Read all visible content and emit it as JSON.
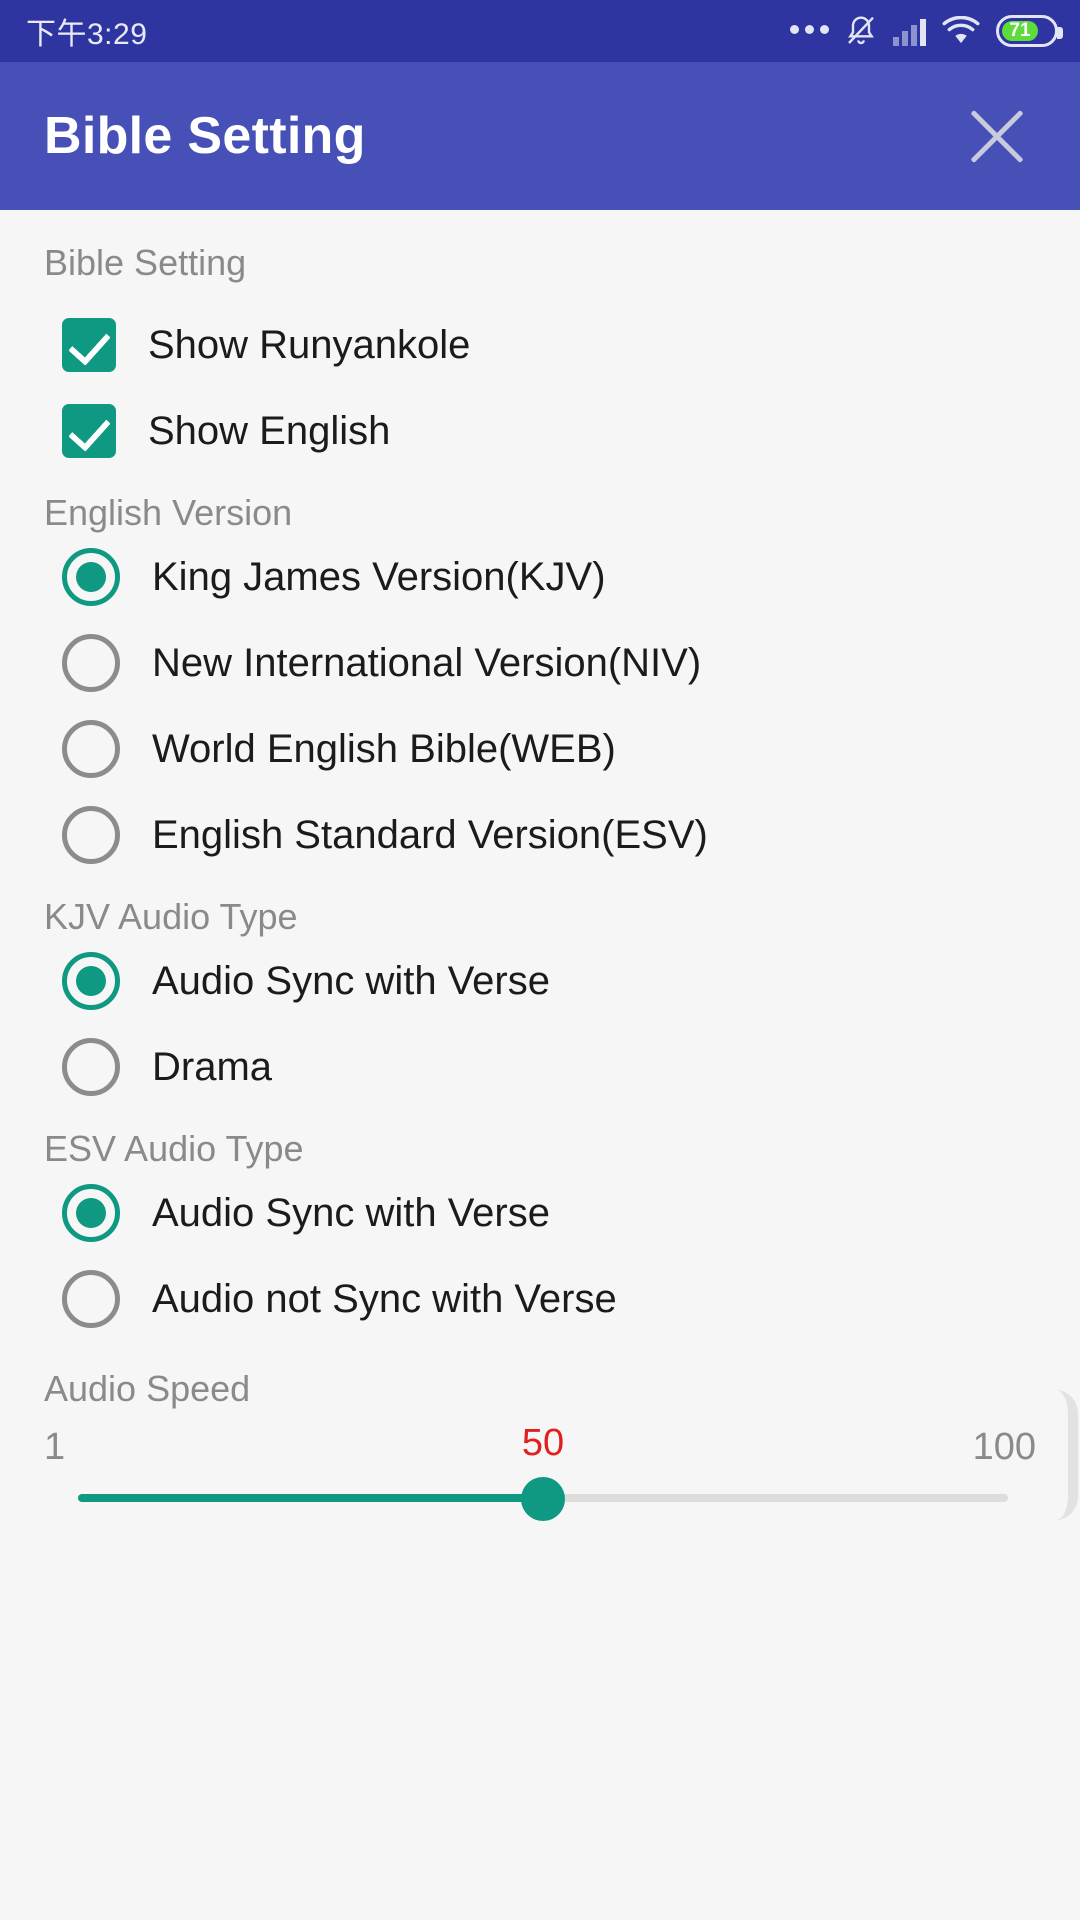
{
  "statusbar": {
    "time": "下午3:29",
    "icons": [
      "more-dots-icon",
      "notifications-off-icon",
      "signal-no-service-icon",
      "wifi-icon",
      "battery-icon"
    ],
    "battery_percent": "71"
  },
  "appbar": {
    "title": "Bible Setting",
    "close_label": "close-icon",
    "background": "#4650b7"
  },
  "theme": {
    "accent": "#0f9882",
    "status_bar_bg": "#2f35a0",
    "page_bg": "#f6f6f6",
    "label_color": "#8a8a8a",
    "value_highlight": "#e02020"
  },
  "sections": {
    "bible_setting": {
      "label": "Bible Setting",
      "checkboxes": [
        {
          "label": "Show Runyankole",
          "checked": true
        },
        {
          "label": "Show English",
          "checked": true
        }
      ]
    },
    "english_version": {
      "label": "English Version",
      "options": [
        {
          "label": "King James Version(KJV)",
          "selected": true
        },
        {
          "label": "New International Version(NIV)",
          "selected": false
        },
        {
          "label": "World English Bible(WEB)",
          "selected": false
        },
        {
          "label": "English Standard Version(ESV)",
          "selected": false
        }
      ]
    },
    "kjv_audio_type": {
      "label": "KJV Audio Type",
      "options": [
        {
          "label": "Audio Sync with Verse",
          "selected": true
        },
        {
          "label": "Drama",
          "selected": false
        }
      ]
    },
    "esv_audio_type": {
      "label": "ESV Audio Type",
      "options": [
        {
          "label": "Audio Sync with Verse",
          "selected": true
        },
        {
          "label": "Audio not Sync with Verse",
          "selected": false
        }
      ]
    },
    "audio_speed": {
      "label": "Audio Speed",
      "min": "1",
      "max": "100",
      "value": "50",
      "percent": 50
    }
  }
}
